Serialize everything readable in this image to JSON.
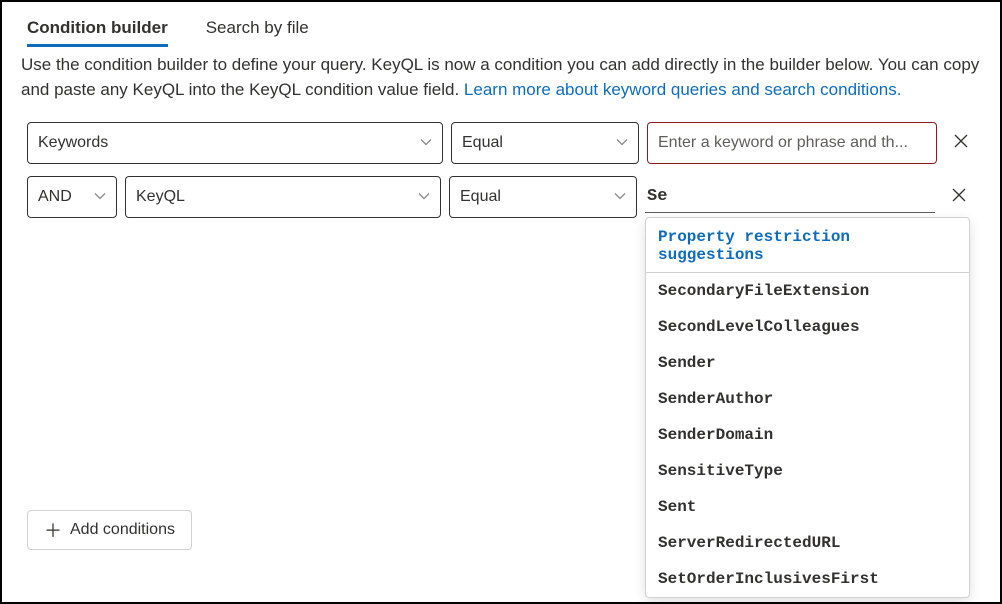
{
  "tabs": {
    "condition_builder": "Condition builder",
    "search_by_file": "Search by file"
  },
  "description": {
    "text": "Use the condition builder to define your query. KeyQL is now a condition you can add directly in the builder below. You can copy and paste any KeyQL into the KeyQL condition value field. ",
    "link_text": "Learn more about keyword queries and search conditions."
  },
  "rows": [
    {
      "property": "Keywords",
      "operator": "Equal",
      "value_placeholder": "Enter a keyword or phrase and th..."
    },
    {
      "logic": "AND",
      "property": "KeyQL",
      "operator": "Equal",
      "value": "Se"
    }
  ],
  "suggestions": {
    "header": "Property restriction suggestions",
    "items": [
      "SecondaryFileExtension",
      "SecondLevelColleagues",
      "Sender",
      "SenderAuthor",
      "SenderDomain",
      "SensitiveType",
      "Sent",
      "ServerRedirectedURL",
      "SetOrderInclusivesFirst"
    ]
  },
  "add_conditions_label": "Add conditions"
}
